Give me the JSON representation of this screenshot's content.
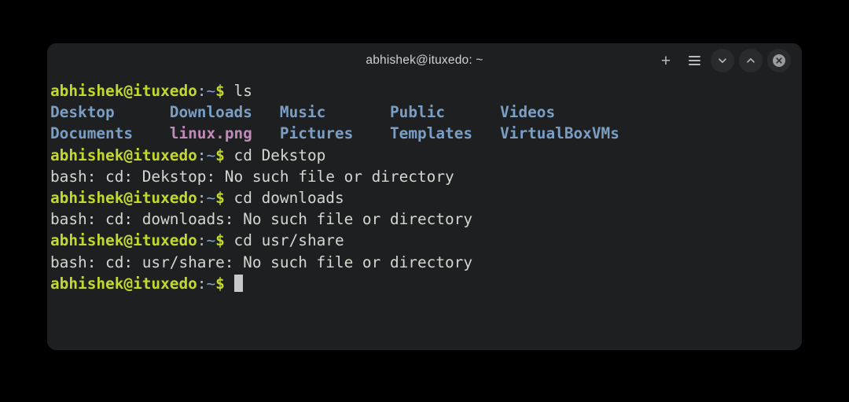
{
  "window": {
    "title": "abhishek@ituxedo: ~",
    "controls": {
      "new_tab_label": "+",
      "menu_name": "hamburger-menu",
      "minimize_name": "chevron-down",
      "maximize_name": "chevron-up",
      "close_name": "close-x"
    }
  },
  "terminal": {
    "prompt": {
      "user_host": "abhishek@ituxedo",
      "colon": ":",
      "path": "~",
      "sigil": "$"
    },
    "colors": {
      "background": "#1e1f21",
      "foreground": "#d3d7cf",
      "prompt_user": "#c3d82c",
      "directory": "#7a9ec4",
      "image_file": "#c08ab8",
      "cursor": "#c8c8c8"
    },
    "commands": {
      "ls": "ls",
      "cd_dekstop": "cd Dekstop",
      "cd_downloads": "cd downloads",
      "cd_usr_share": "cd usr/share"
    },
    "ls_output": {
      "row1": {
        "col1": "Desktop",
        "col2": "Downloads",
        "col3": "Music",
        "col4": "Public",
        "col5": "Videos"
      },
      "row2": {
        "col1": "Documents",
        "col2": "linux.png",
        "col3": "Pictures",
        "col4": "Templates",
        "col5": "VirtualBoxVMs"
      },
      "gap1": "   ",
      "gap2": "   ",
      "gap3": "      ",
      "gap4": "     ",
      "gap2b": "   ",
      "gap3b": "   ",
      "gap4b": "   ",
      "gap5b": "   "
    },
    "errors": {
      "dekstop": "bash: cd: Dekstop: No such file or directory",
      "downloads": "bash: cd: downloads: No such file or directory",
      "usr_share": "bash: cd: usr/share: No such file or directory"
    }
  }
}
